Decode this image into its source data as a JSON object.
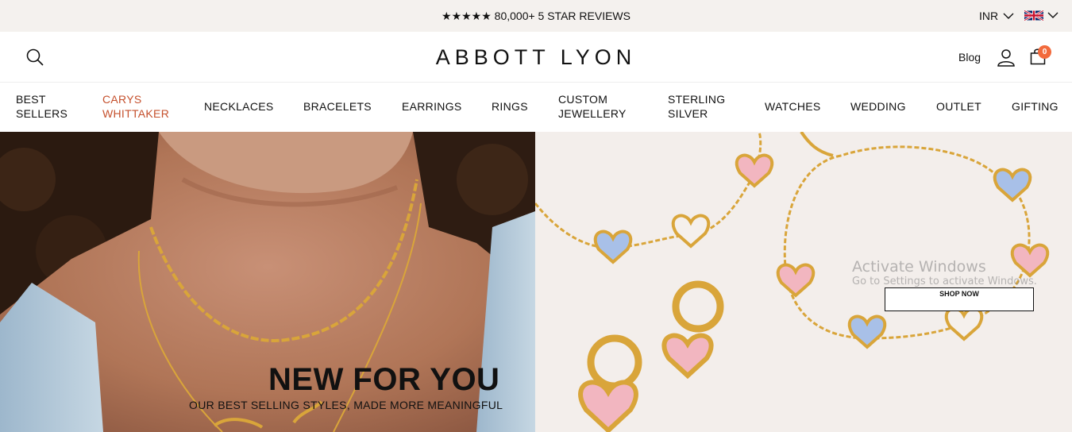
{
  "topbar": {
    "reviews": "★★★★★ 80,000+ 5 STAR REVIEWS",
    "currency": "INR",
    "flag_icon": "uk-flag-icon"
  },
  "header": {
    "logo": "ABBOTT LYON",
    "blog": "Blog",
    "cart_count": "0",
    "icons": [
      "search-icon",
      "user-icon",
      "shopping-bag-icon"
    ]
  },
  "nav": {
    "items": [
      {
        "line1": "BEST",
        "line2": "SELLERS"
      },
      {
        "line1": "CARYS",
        "line2": "WHITTAKER"
      },
      {
        "line1": "NECKLACES",
        "line2": ""
      },
      {
        "line1": "BRACELETS",
        "line2": ""
      },
      {
        "line1": "EARRINGS",
        "line2": ""
      },
      {
        "line1": "RINGS",
        "line2": ""
      },
      {
        "line1": "CUSTOM",
        "line2": "JEWELLERY"
      },
      {
        "line1": "STERLING",
        "line2": "SILVER"
      },
      {
        "line1": "WATCHES",
        "line2": ""
      },
      {
        "line1": "WEDDING",
        "line2": ""
      },
      {
        "line1": "OUTLET",
        "line2": ""
      },
      {
        "line1": "GIFTING",
        "line2": ""
      }
    ],
    "accent_color": "#c5502c"
  },
  "hero": {
    "title": "NEW FOR YOU",
    "subtitle": "OUR BEST SELLING STYLES, MADE MORE MEANINGFUL",
    "button": "SHOP NOW"
  },
  "watermark": {
    "line1": "Activate Windows",
    "line2": "Go to Settings to activate Windows."
  },
  "colors": {
    "topbar_bg": "#f4f1ee",
    "badge": "#f26a3c",
    "gold": "#d9a53a"
  }
}
